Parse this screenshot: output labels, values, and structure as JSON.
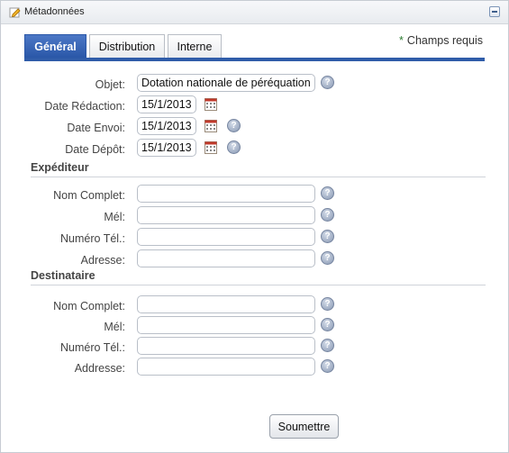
{
  "panel": {
    "title": "Métadonnées",
    "title_icon": "pencil-icon",
    "collapse_icon": "minus-icon"
  },
  "tabs": [
    {
      "label": "Général",
      "active": true
    },
    {
      "label": "Distribution",
      "active": false
    },
    {
      "label": "Interne",
      "active": false
    }
  ],
  "required_note": {
    "star": "*",
    "text": "Champs requis"
  },
  "general": {
    "objet": {
      "label": "Objet:",
      "value": "Dotation nationale de péréquation"
    },
    "date_redaction": {
      "label": "Date Rédaction:",
      "value": "15/1/2013"
    },
    "date_envoi": {
      "label": "Date Envoi:",
      "value": "15/1/2013"
    },
    "date_depot": {
      "label": "Date Dépôt:",
      "value": "15/1/2013"
    }
  },
  "expediteur": {
    "heading": "Expéditeur",
    "nom_label": "Nom Complet:",
    "nom_value": "",
    "mel_label": "Mél:",
    "mel_value": "",
    "tel_label": "Numéro Tél.:",
    "tel_value": "",
    "adresse_label": "Adresse:",
    "adresse_value": ""
  },
  "destinataire": {
    "heading": "Destinataire",
    "nom_label": "Nom Complet:",
    "nom_value": "",
    "mel_label": "Mél:",
    "mel_value": "",
    "tel_label": "Numéro Tél.:",
    "tel_value": "",
    "adresse_label": "Addresse:",
    "adresse_value": ""
  },
  "help_glyph": "?",
  "submit_label": "Soumettre",
  "colors": {
    "accent": "#2f5ca9",
    "required_star": "#2e7d32"
  }
}
